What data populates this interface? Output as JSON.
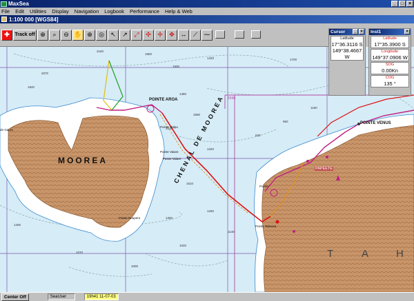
{
  "window": {
    "title": "MaxSea",
    "controls": [
      "_",
      "□",
      "×"
    ]
  },
  "menu": [
    "File",
    "Edit",
    "Utilities",
    "Display",
    "Navigation",
    "Logbook",
    "Performance",
    "Help & Web"
  ],
  "document": {
    "title": "1:100 000 [WGS84]"
  },
  "toolbar": {
    "track_label": "Track off"
  },
  "cursor_panel": {
    "title": "Cursor",
    "latitude_label": "Latitude",
    "latitude": "17°36.3116 S",
    "longitude": "149°38.4667 W"
  },
  "inst_panel": {
    "title": "Inst1",
    "latitude_label": "Latitude",
    "latitude": "17°35.3900 S",
    "longitude_label": "Longitude",
    "longitude": "149°37.0906 W",
    "sog_label": "SOG",
    "sog": "0.00Kn",
    "cog_label": "COG",
    "cog": "135 °"
  },
  "map": {
    "island_west": "MOOREA",
    "channel": "CHENAL DE MOOREA",
    "island_east_letters": [
      "T",
      "A",
      "H"
    ],
    "places": {
      "pointe_aroa": "POINTE AROA",
      "pointe_venus": "POINTE VENUS",
      "papeete": "PAPEETE",
      "pointe_taharaa": "Pointe Taharaa",
      "pointe_tatipu": "Pointe Tatipu",
      "pointe_vaiare": "Pointe Vaiare",
      "pointe_nuupere": "Pointe Nuupere",
      "pointe": "Pointe",
      "passe_vaiare": "Passe Vaiare",
      "baie_cook": "de Gaura"
    },
    "sheet_number": "6598",
    "colors": {
      "sea": "#d6ecf7",
      "reef": "#ffffff",
      "land": "#c8956a",
      "track": "#dd1111",
      "route": "#c01f80",
      "grid": "#6a4aa0"
    }
  },
  "status": {
    "center_button": "Center Off",
    "sea_user": "SeaUser",
    "time": "19h41 11-07-03"
  }
}
